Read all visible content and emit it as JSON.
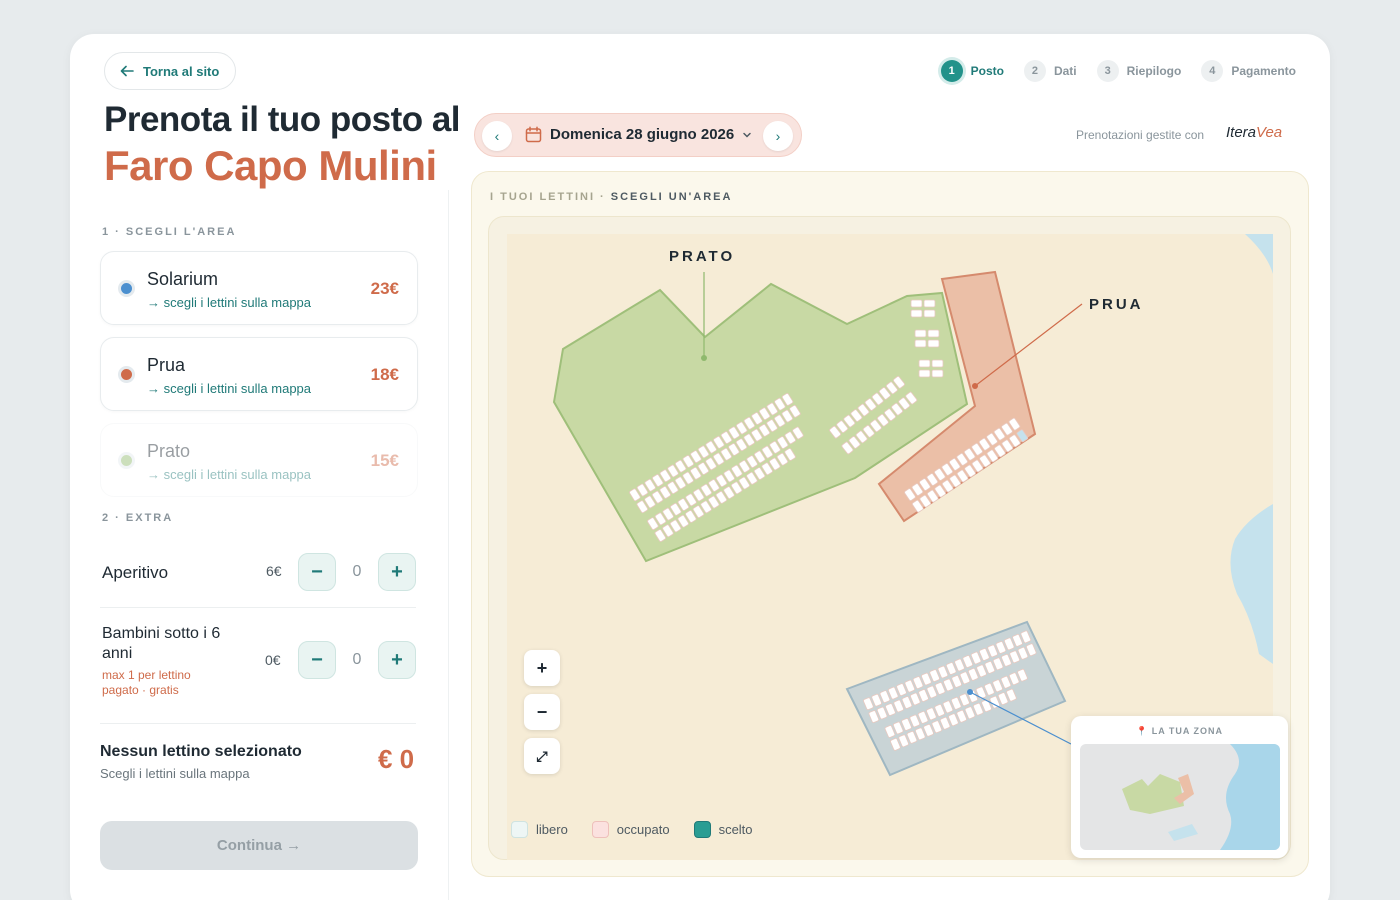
{
  "nav": {
    "back_label": "Torna al sito"
  },
  "title": {
    "line1": "Prenota il tuo posto al",
    "line2": "Faro Capo Mulini"
  },
  "steps": [
    {
      "num": "1",
      "label": "Posto",
      "active": true
    },
    {
      "num": "2",
      "label": "Dati",
      "active": false
    },
    {
      "num": "3",
      "label": "Riepilogo",
      "active": false
    },
    {
      "num": "4",
      "label": "Pagamento",
      "active": false
    }
  ],
  "date": {
    "prev": "‹",
    "next": "›",
    "label": "Domenica 28 giugno 2026"
  },
  "managed_by": {
    "text": "Prenotazioni gestite con",
    "logo_a": "Itera",
    "logo_b": "Vea"
  },
  "areas_section": {
    "label": "1 · SCEGLI L'AREA"
  },
  "areas": [
    {
      "name": "Solarium",
      "link": "→ scegli i lettini sulla mappa",
      "price": "23€",
      "color": "#4b8fcf"
    },
    {
      "name": "Prua",
      "link": "→ scegli i lettini sulla mappa",
      "price": "18€",
      "color": "#cf6b4a"
    },
    {
      "name": "Prato",
      "link": "→ scegli i lettini sulla mappa",
      "price": "15€",
      "color": "#8fb96d"
    }
  ],
  "extras_section": {
    "label": "2 · EXTRA"
  },
  "extras": [
    {
      "name": "Aperitivo",
      "price": "6€",
      "qty": "0",
      "minus": "−",
      "plus": "+"
    },
    {
      "name_line1": "Bambini sotto i 6",
      "name_line2": "anni",
      "note_line1": "max 1 per lettino",
      "note_line2": "pagato · gratis",
      "price": "0€",
      "qty": "0",
      "minus": "−",
      "plus": "+"
    }
  ],
  "summary": {
    "title": "Nessun lettino selezionato",
    "subtitle": "Scegli i lettini sulla mappa",
    "total": "€ 0"
  },
  "continue": {
    "label": "Continua →"
  },
  "map": {
    "heading_a": "I TUOI LETTINI · ",
    "heading_b": "SCEGLI UN'AREA",
    "label_prato": "PRATO",
    "label_prua": "PRUA",
    "zoom_in": "+",
    "zoom_out": "−",
    "fullscreen": "⤢",
    "minimap_label": "📍 LA TUA ZONA"
  },
  "legend": [
    {
      "label": "libero",
      "color": "#eef6f5"
    },
    {
      "label": "occupato",
      "color": "#fbe1df"
    },
    {
      "label": "scelto",
      "color": "#2a9d93"
    }
  ],
  "colors": {
    "accent": "#207a78",
    "brand": "#cf6b4a",
    "prato_fill": "#c8d9a4",
    "prua_fill": "#ebbfa7",
    "solarium_fill": "#c9d4d6",
    "sea": "#c5e2ed"
  }
}
